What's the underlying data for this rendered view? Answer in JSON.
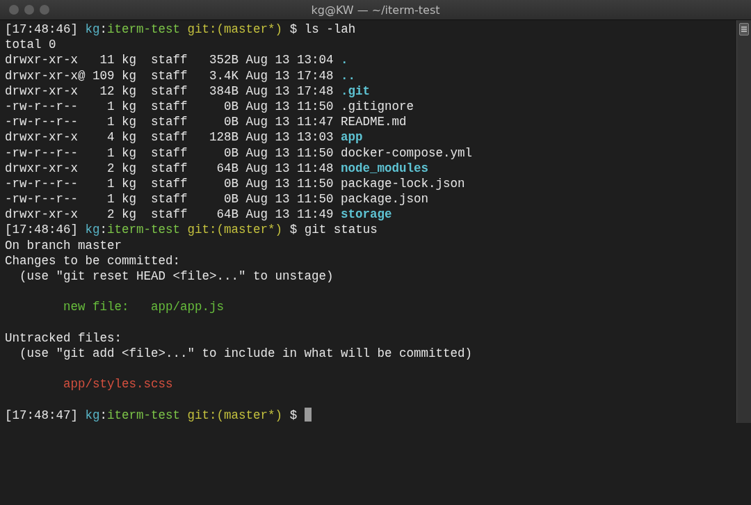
{
  "window": {
    "title": "kg@KW — ~/iterm-test"
  },
  "terminal": {
    "lines": [
      {
        "kind": "text",
        "segments": [
          {
            "text": "[17:48:46] ",
            "kind": "plain"
          },
          {
            "text": "kg",
            "kind": "user"
          },
          {
            "text": ":",
            "kind": "plain"
          },
          {
            "text": "iterm-test",
            "kind": "path"
          },
          {
            "text": " git:(master*)",
            "kind": "git"
          },
          {
            "text": " $ ls -lah",
            "kind": "plain"
          }
        ]
      },
      {
        "kind": "text",
        "segments": [
          {
            "text": "total 0",
            "kind": "plain"
          }
        ]
      },
      {
        "kind": "text",
        "segments": [
          {
            "text": "drwxr-xr-x   11 kg  staff   352B Aug 13 13:04 ",
            "kind": "plain"
          },
          {
            "text": ".",
            "kind": "dir"
          }
        ]
      },
      {
        "kind": "text",
        "segments": [
          {
            "text": "drwxr-xr-x@ 109 kg  staff   3.4K Aug 13 17:48 ",
            "kind": "plain"
          },
          {
            "text": "..",
            "kind": "dir"
          }
        ]
      },
      {
        "kind": "text",
        "segments": [
          {
            "text": "drwxr-xr-x   12 kg  staff   384B Aug 13 17:48 ",
            "kind": "plain"
          },
          {
            "text": ".git",
            "kind": "dir"
          }
        ]
      },
      {
        "kind": "text",
        "segments": [
          {
            "text": "-rw-r--r--    1 kg  staff     0B Aug 13 11:50 .gitignore",
            "kind": "plain"
          }
        ]
      },
      {
        "kind": "text",
        "segments": [
          {
            "text": "-rw-r--r--    1 kg  staff     0B Aug 13 11:47 README.md",
            "kind": "plain"
          }
        ]
      },
      {
        "kind": "text",
        "segments": [
          {
            "text": "drwxr-xr-x    4 kg  staff   128B Aug 13 13:03 ",
            "kind": "plain"
          },
          {
            "text": "app",
            "kind": "dir"
          }
        ]
      },
      {
        "kind": "text",
        "segments": [
          {
            "text": "-rw-r--r--    1 kg  staff     0B Aug 13 11:50 docker-compose.yml",
            "kind": "plain"
          }
        ]
      },
      {
        "kind": "text",
        "segments": [
          {
            "text": "drwxr-xr-x    2 kg  staff    64B Aug 13 11:48 ",
            "kind": "plain"
          },
          {
            "text": "node_modules",
            "kind": "dir"
          }
        ]
      },
      {
        "kind": "text",
        "segments": [
          {
            "text": "-rw-r--r--    1 kg  staff     0B Aug 13 11:50 package-lock.json",
            "kind": "plain"
          }
        ]
      },
      {
        "kind": "text",
        "segments": [
          {
            "text": "-rw-r--r--    1 kg  staff     0B Aug 13 11:50 package.json",
            "kind": "plain"
          }
        ]
      },
      {
        "kind": "text",
        "segments": [
          {
            "text": "drwxr-xr-x    2 kg  staff    64B Aug 13 11:49 ",
            "kind": "plain"
          },
          {
            "text": "storage",
            "kind": "dir"
          }
        ]
      },
      {
        "kind": "text",
        "segments": [
          {
            "text": "[17:48:46] ",
            "kind": "plain"
          },
          {
            "text": "kg",
            "kind": "user"
          },
          {
            "text": ":",
            "kind": "plain"
          },
          {
            "text": "iterm-test",
            "kind": "path"
          },
          {
            "text": " git:(master*)",
            "kind": "git"
          },
          {
            "text": " $ git status",
            "kind": "plain"
          }
        ]
      },
      {
        "kind": "text",
        "segments": [
          {
            "text": "On branch master",
            "kind": "plain"
          }
        ]
      },
      {
        "kind": "text",
        "segments": [
          {
            "text": "Changes to be committed:",
            "kind": "plain"
          }
        ]
      },
      {
        "kind": "text",
        "segments": [
          {
            "text": "  (use \"git reset HEAD <file>...\" to unstage)",
            "kind": "plain"
          }
        ]
      },
      {
        "kind": "blank"
      },
      {
        "kind": "text",
        "segments": [
          {
            "text": "        new file:   app/app.js",
            "kind": "staged"
          }
        ]
      },
      {
        "kind": "blank"
      },
      {
        "kind": "text",
        "segments": [
          {
            "text": "Untracked files:",
            "kind": "plain"
          }
        ]
      },
      {
        "kind": "text",
        "segments": [
          {
            "text": "  (use \"git add <file>...\" to include in what will be committed)",
            "kind": "plain"
          }
        ]
      },
      {
        "kind": "blank"
      },
      {
        "kind": "text",
        "segments": [
          {
            "text": "        app/styles.scss",
            "kind": "untracked"
          }
        ]
      },
      {
        "kind": "blank"
      },
      {
        "kind": "text",
        "segments": [
          {
            "text": "[17:48:47] ",
            "kind": "plain"
          },
          {
            "text": "kg",
            "kind": "user"
          },
          {
            "text": ":",
            "kind": "plain"
          },
          {
            "text": "iterm-test",
            "kind": "path"
          },
          {
            "text": " git:(master*)",
            "kind": "git"
          },
          {
            "text": " $ ",
            "kind": "plain"
          }
        ]
      }
    ],
    "cursor_visible": true
  }
}
